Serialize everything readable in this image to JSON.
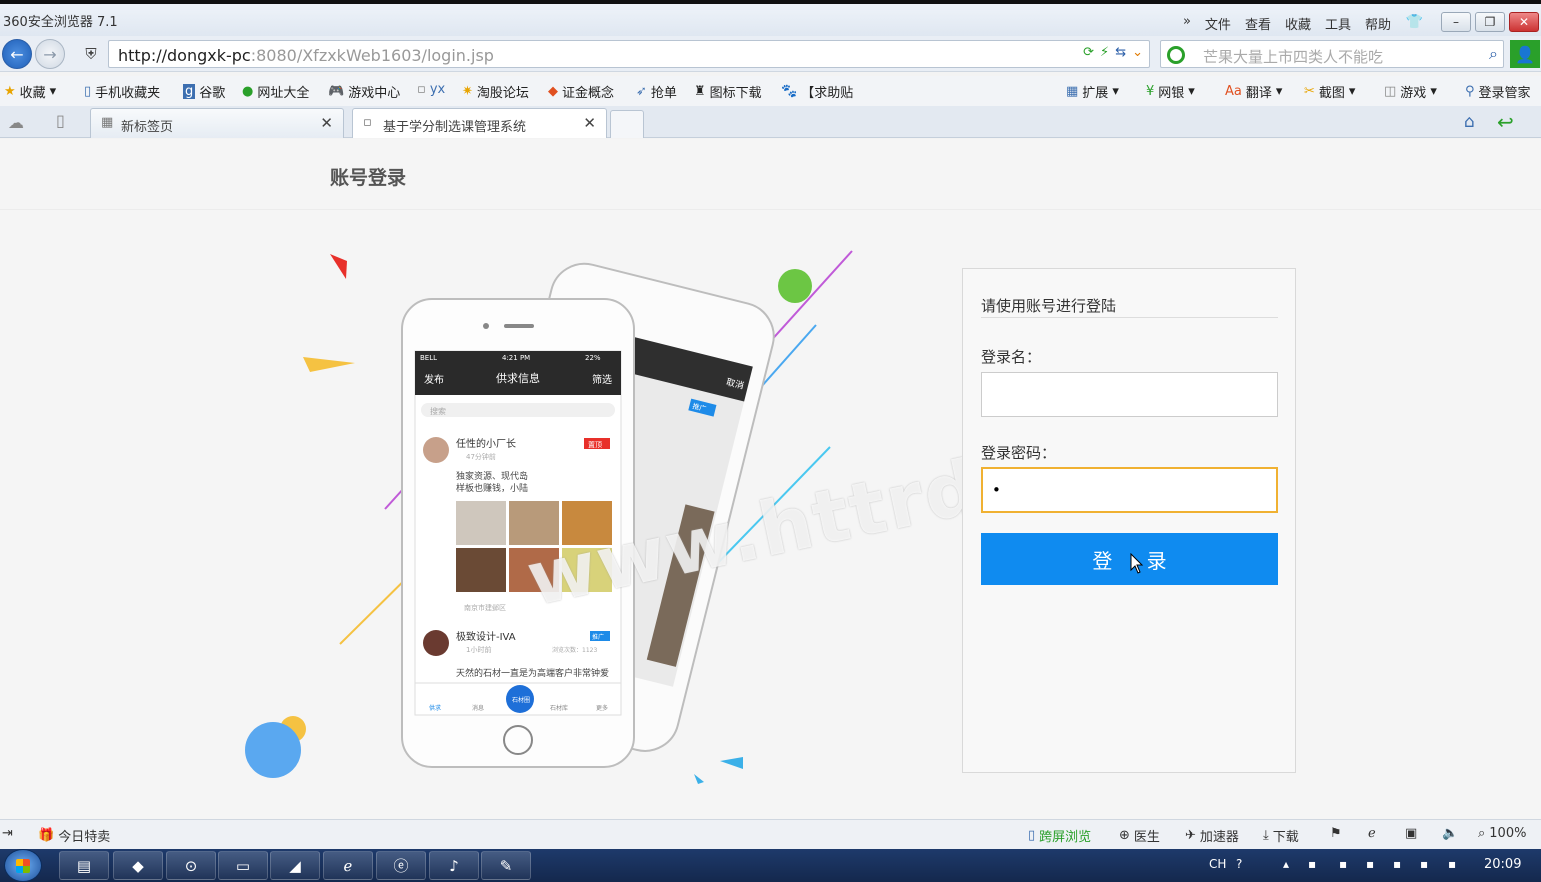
{
  "browser": {
    "app_title": "360安全浏览器 7.1",
    "menus": [
      "文件",
      "查看",
      "收藏",
      "工具",
      "帮助"
    ],
    "url_host": "http://dongxk-pc",
    "url_rest": ":8080/XfzxkWeb1603/login.jsp",
    "search_placeholder": "芒果大量上市四类人不能吃",
    "bookmarks": [
      "收藏",
      "手机收藏夹",
      "谷歌",
      "网址大全",
      "游戏中心",
      "yx",
      "淘股论坛",
      "证金概念",
      "抢单",
      "图标下载",
      "【求助贴"
    ],
    "tools": [
      "扩展",
      "网银",
      "翻译",
      "截图",
      "游戏",
      "登录管家"
    ],
    "tabs": [
      {
        "label": "新标签页"
      },
      {
        "label": "基于学分制选课管理系统"
      }
    ]
  },
  "page": {
    "header": "账号登录",
    "panel_title": "请使用账号进行登陆",
    "username_label": "登录名：",
    "username_value": "",
    "password_label": "登录密码：",
    "password_value": "•",
    "login_button": "登 录",
    "watermark": "www.httrd.com"
  },
  "phone": {
    "status_carrier": "BELL",
    "status_time": "4:21 PM",
    "status_battery": "22%",
    "nav_left": "发布",
    "nav_title": "供求信息",
    "nav_right": "筛选",
    "search_placeholder": "搜索",
    "post1_name": "任性的小厂长",
    "post1_time": "47分钟前",
    "post1_badge": "置顶",
    "post1_text1": "独家资源、现代岛",
    "post1_text2": "样板也赚钱，小陆",
    "post1_location": "南京市建邺区",
    "post2_name": "极致设计-IVA",
    "post2_time": "1小时前",
    "post2_badge": "推广",
    "post2_views": "浏览次数：1123",
    "post2_text": "天然的石材一直是为高端客户非常钟爱",
    "tabbar": [
      "供求",
      "消息",
      "石材圈",
      "石材库",
      "更多"
    ],
    "back_badge": "推广",
    "back_cancel": "取消"
  },
  "statusbar": {
    "left": "今日特卖",
    "items": [
      "跨屏浏览",
      "医生",
      "加速器",
      "下载"
    ],
    "zoom": "100%"
  },
  "taskbar": {
    "lang": "CH",
    "time": "20:09"
  },
  "colors": {
    "primary_button": "#0f8bf0",
    "focus_border": "#f0b132",
    "green": "#2aa02a"
  }
}
